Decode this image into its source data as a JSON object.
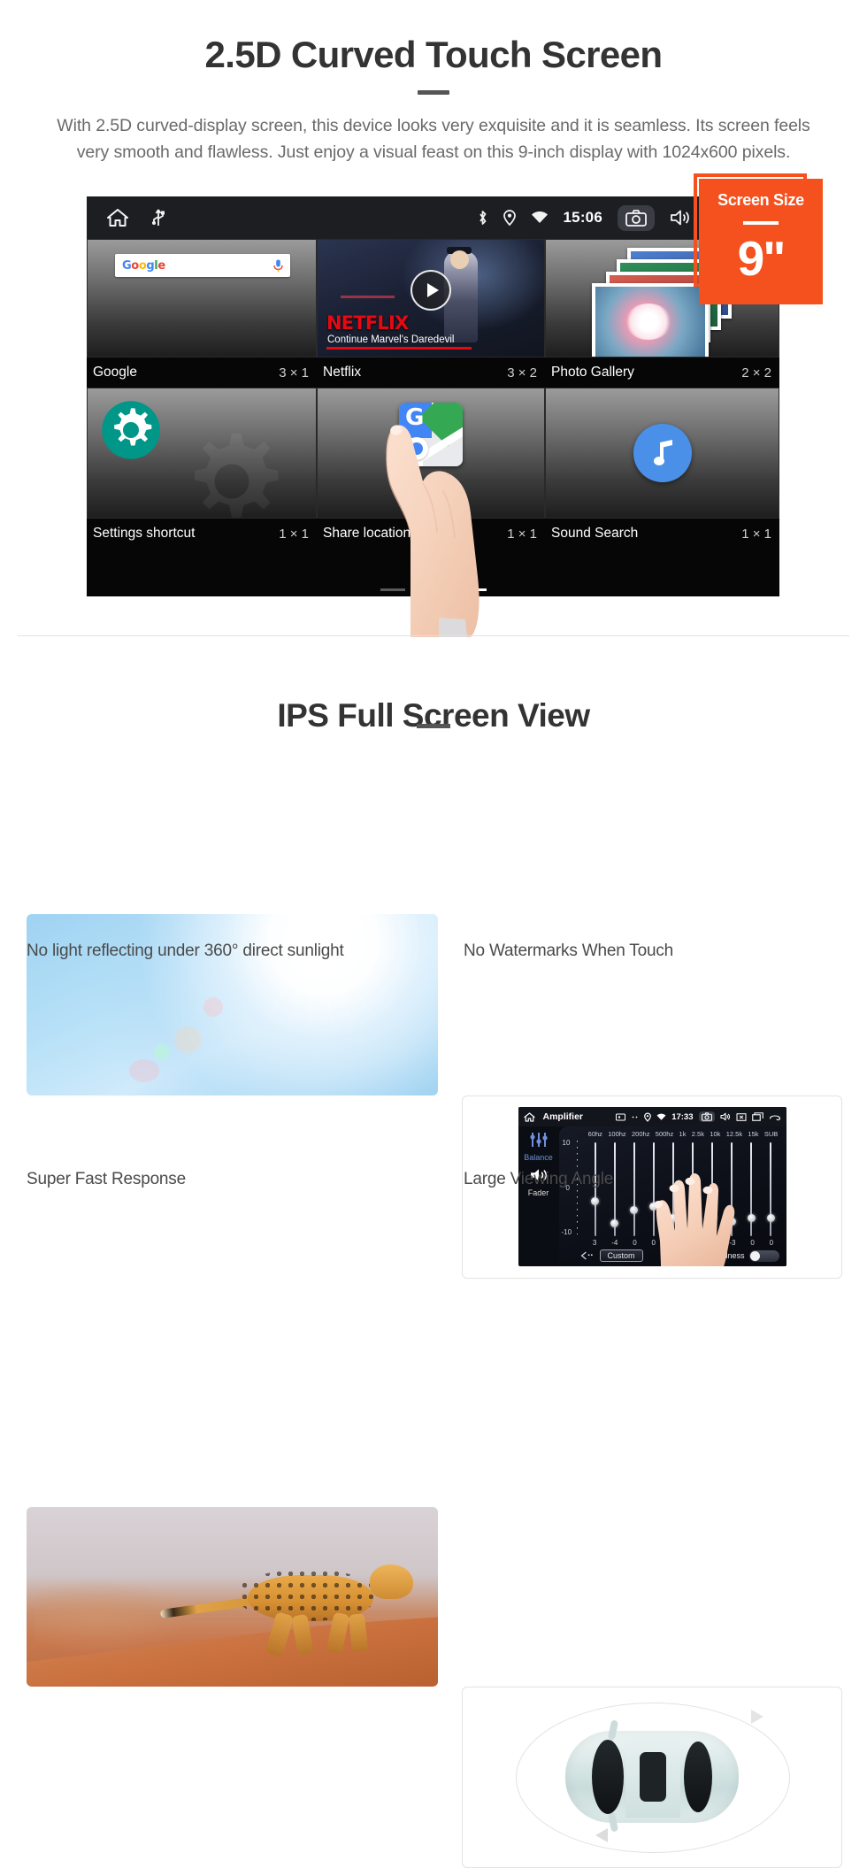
{
  "section1": {
    "title": "2.5D Curved Touch Screen",
    "paragraph": "With 2.5D curved-display screen, this device looks very exquisite and it is seamless. Its screen feels very smooth and flawless. Just enjoy a visual feast on this 9-inch display with 1024x600 pixels.",
    "badge": {
      "label": "Screen Size",
      "value": "9\"",
      "color": "#F4511E"
    },
    "device": {
      "statusbar": {
        "time": "15:06",
        "left_icons": [
          "home-icon",
          "usb-icon"
        ],
        "right_icons": [
          "bluetooth-icon",
          "location-icon",
          "wifi-icon",
          "camera-icon",
          "volume-icon",
          "close-box-icon",
          "recent-apps-icon"
        ]
      },
      "widgets": [
        {
          "name": "Google",
          "size": "3 × 1",
          "icon": "google-search-widget",
          "search_placeholder": "Google"
        },
        {
          "name": "Netflix",
          "size": "3 × 2",
          "icon": "netflix-widget",
          "brand": "NETFLIX",
          "subtitle": "Continue Marvel's Daredevil"
        },
        {
          "name": "Photo Gallery",
          "size": "2 × 2",
          "icon": "photo-gallery-widget"
        },
        {
          "name": "Settings shortcut",
          "size": "1 × 1",
          "icon": "gear-icon"
        },
        {
          "name": "Share location",
          "size": "1 × 1",
          "icon": "google-maps-icon"
        },
        {
          "name": "Sound Search",
          "size": "1 × 1",
          "icon": "music-note-icon"
        }
      ],
      "page_dots": 3,
      "active_dot": 3
    }
  },
  "section2": {
    "title": "IPS Full Screen View",
    "cards": [
      {
        "caption": "No light reflecting under 360° direct sunlight",
        "image": "sunlight-sky-photo"
      },
      {
        "caption": "No Watermarks When Touch",
        "image": "amplifier-equalizer-screenshot"
      },
      {
        "caption": "Super Fast Response",
        "image": "running-cheetah-photo"
      },
      {
        "caption": "Large Viewing Angle",
        "image": "car-top-view-illustration"
      }
    ]
  },
  "amplifier": {
    "title": "Amplifier",
    "time": "17:33",
    "side_labels": [
      "Balance",
      "Fader"
    ],
    "frequencies": [
      "60hz",
      "100hz",
      "200hz",
      "500hz",
      "1k",
      "2.5k",
      "10k",
      "12.5k",
      "15k",
      "SUB"
    ],
    "values": [
      "3",
      "-4",
      "0",
      "0",
      "0",
      "-3",
      "0",
      "-3",
      "0",
      "0"
    ],
    "scale_top": "10",
    "scale_mid": "0",
    "scale_bottom": "-10",
    "preset_label": "Custom",
    "loudness_label": "loudness",
    "loudness_on": false
  }
}
